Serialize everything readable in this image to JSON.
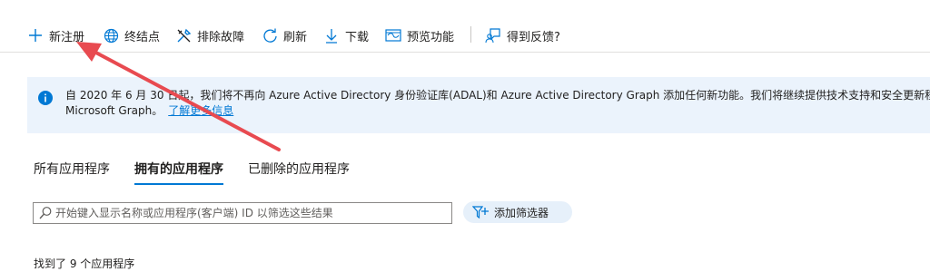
{
  "toolbar": {
    "new_registration": "新注册",
    "endpoints": "终结点",
    "troubleshoot": "排除故障",
    "refresh": "刷新",
    "download": "下载",
    "preview_features": "预览功能",
    "feedback": "得到反馈?"
  },
  "banner": {
    "line1": "自 2020 年 6 月 30 日起，我们将不再向 Azure Active Directory 身份验证库(ADAL)和 Azure Active Directory Graph 添加任何新功能。我们将继续提供技术支持和安全更新程序",
    "line2": "Microsoft Graph。",
    "link": "了解更多信息"
  },
  "tabs": [
    {
      "label": "所有应用程序"
    },
    {
      "label": "拥有的应用程序"
    },
    {
      "label": "已删除的应用程序"
    }
  ],
  "search": {
    "placeholder": "开始键入显示名称或应用程序(客户端) ID 以筛选这些结果"
  },
  "filter": {
    "label": "添加筛选器"
  },
  "results": {
    "count_text": "找到了 9 个应用程序"
  },
  "colors": {
    "accent": "#0078d4",
    "banner_bg": "#ebf3fc",
    "annotation_arrow": "#e84a50"
  }
}
